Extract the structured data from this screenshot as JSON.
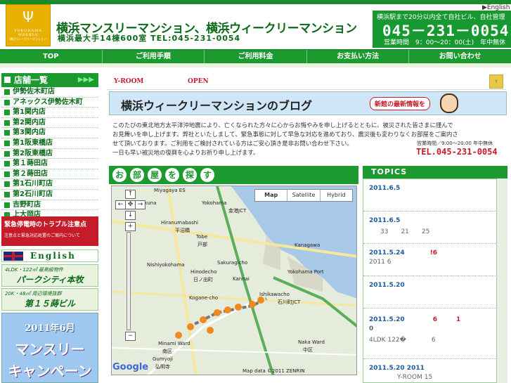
{
  "header": {
    "logo_line1": "YOKOHAMA WEEKLY",
    "logo_line2": "横浜ウィークリーマンション",
    "title": "横浜マンスリーマンション、横浜ウィークリーマンション",
    "address": "横浜最大手14棟600室 TEL:045-231-0054",
    "english_link": "▶English",
    "phone_note": "横浜駅まで20分以内全て自社ビル、自社管理",
    "phone": "045－231－0054",
    "hours": "営業時間　9：00～20：00(土)　年中無休"
  },
  "nav": [
    "TOP",
    "ご利用手順",
    "ご利用料金",
    "お支払い方法",
    "お問い合わせ"
  ],
  "sidebar": {
    "heading": "店舗一覧",
    "arrows": "▶▶▶",
    "shops": [
      "伊勢佐木町店",
      "アネックス伊勢佐木町",
      "第1関内店",
      "第2関内店",
      "第3関内店",
      "第1阪東橋店",
      "第2阪東橋店",
      "第１蒔田店",
      "第２蒔田店",
      "第1石川町店",
      "第2石川町店",
      "吉野町店",
      "上大岡店"
    ],
    "trouble_title": "緊急停電時のトラブル注意点",
    "trouble_sub": "注意点と緊急対応処置のご案内について",
    "english": "English",
    "banner1_sub": "4LDK・122㎡ 最高級物件",
    "banner1_main": "パークシティ本牧",
    "banner2_sub": "20K・48㎡ 周辺環境抜群",
    "banner2_main": "第１５蒔ビル",
    "campaign_1": "2011年6月",
    "campaign_2": "マンスリー",
    "campaign_3": "キャンペーン"
  },
  "main": {
    "yroom": "Y-ROOM",
    "open": "OPEN",
    "blog_title": "横浜ウィークリーマンションのブログ",
    "blog_new": "新館の最新情報を",
    "notice_lines": [
      "このたびの東北地方太平洋沖地震により、亡くなられた方々に心からお悔やみを申し上げるとともに、被災された皆さまに謹んで",
      "お見舞いを申し上げます。弊社といたしまして、緊急事態に対して早急な対応を進めており、震災後も変わりなくお部屋をご案内さ",
      "せて頂いております。ご利用をご検討されている方はご安心頂き是非お問い合わせ下さい。",
      "一日も早い被災地の復興を心よりお祈り申し上げます。"
    ],
    "notice_hours": "営業時間／9:00～20:00 年中無休",
    "notice_tel": "TEL.045-231-0054",
    "map_heading": [
      "お",
      "部",
      "屋",
      "を",
      "探",
      "す"
    ],
    "map_types": [
      "Map",
      "Satellite",
      "Hybrid"
    ],
    "map_copy": "Map data ©2011 ZENRIN",
    "map_google": "Google",
    "map_labels": [
      "Miyagaya ES",
      "Yokohama",
      "金港JCT",
      "Kanagawa",
      "Hiranumabashi",
      "平沼橋",
      "Sakuragicho",
      "Nishiyokohama",
      "Kannai",
      "Kogane-cho",
      "Ishikawacho",
      "石川町JCT",
      "Minami Ward",
      "南区",
      "Naka Ward",
      "中区",
      "Gumyoji",
      "弘明寺",
      "Hinodecho",
      "日ノ出町",
      "Kikuna",
      "Tobe",
      "戸部",
      "Yokohama Port"
    ],
    "topics_heading": "TOPICS",
    "topics": [
      {
        "date": "2011.6.5",
        "text": ""
      },
      {
        "date": "2011.6.5",
        "text": "33　　21　　25"
      },
      {
        "date": "2011.5.24",
        "text": "2011 6",
        "mark": "!6"
      },
      {
        "date": "2011.5.20",
        "text": ""
      },
      {
        "date": "2011.5.20",
        "text": "4LDK 122�　　　　6",
        "mark": "6　　　1",
        "mark2": "0"
      },
      {
        "date": "2011.5.20 2011",
        "text": "Y-ROOM 15"
      }
    ]
  }
}
